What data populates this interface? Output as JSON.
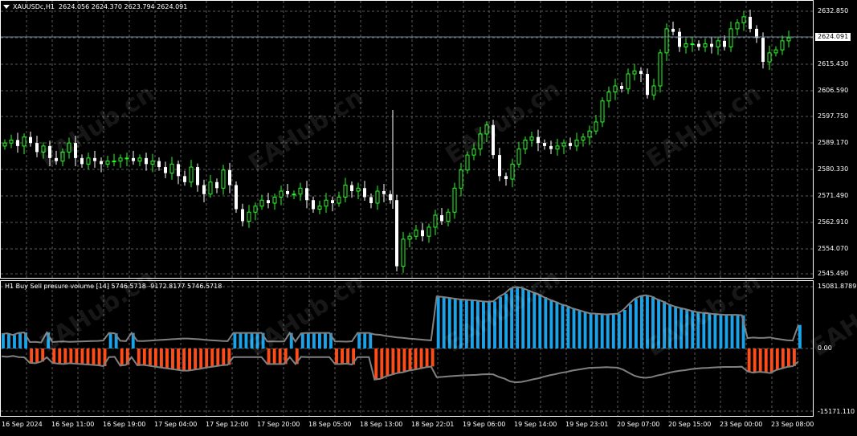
{
  "main_panel": {
    "symbol_title": "XAUUSDc,H1",
    "ohlc": "2624.056 2624.370 2623.794 2624.091",
    "current_price_label": "2624.091",
    "price_axis_labels": [
      "2632.850",
      "2615.430",
      "2606.590",
      "2597.750",
      "2589.170",
      "2580.330",
      "2571.490",
      "2562.910",
      "2554.070",
      "2545.490"
    ],
    "bull_color": "#22ff22",
    "bear_color": "#ffffff",
    "grid_color": "#5a5a5a"
  },
  "indicator_panel": {
    "title": "H1 Buy Sell presure volume [14] 5746.5718 -9172.8177 5746.5718",
    "axis_labels": [
      "15081.8789",
      "0.00",
      "-15171.110"
    ],
    "buy_color": "#1aa3e8",
    "sell_color": "#ff4d1a",
    "envelope_color": "#808080"
  },
  "time_axis": [
    "16 Sep 2024",
    "16 Sep 11:00",
    "16 Sep 19:00",
    "17 Sep 04:00",
    "17 Sep 12:00",
    "17 Sep 20:00",
    "18 Sep 05:00",
    "18 Sep 13:00",
    "18 Sep 22:01",
    "19 Sep 06:00",
    "19 Sep 14:00",
    "19 Sep 23:01",
    "20 Sep 07:00",
    "20 Sep 15:00",
    "23 Sep 00:00",
    "23 Sep 08:00"
  ],
  "watermark_text": "EAHub.cn",
  "chart_data": {
    "type": "candlestick",
    "title": "XAUUSDc,H1",
    "ylim": [
      2545.49,
      2632.85
    ],
    "close_series": [
      2589,
      2590,
      2588,
      2591,
      2589,
      2586,
      2588,
      2584,
      2583,
      2586,
      2589,
      2584,
      2582,
      2584,
      2583,
      2582,
      2583,
      2583,
      2584,
      2584,
      2583,
      2584,
      2582,
      2583,
      2581,
      2579,
      2582,
      2578,
      2576,
      2581,
      2575,
      2572,
      2576,
      2574,
      2580,
      2575,
      2567,
      2563,
      2566,
      2568,
      2570,
      2569,
      2571,
      2573,
      2572,
      2572,
      2574,
      2570,
      2567,
      2568,
      2570,
      2569,
      2571,
      2575,
      2573,
      2574,
      2571,
      2569,
      2573,
      2572,
      2570,
      2548,
      2557,
      2558,
      2560,
      2558,
      2561,
      2565,
      2563,
      2566,
      2574,
      2580,
      2585,
      2587,
      2592,
      2595,
      2585,
      2578,
      2577,
      2582,
      2587,
      2590,
      2591,
      2589,
      2588,
      2587,
      2588,
      2589,
      2588,
      2590,
      2591,
      2593,
      2596,
      2603,
      2606,
      2608,
      2607,
      2612,
      2613,
      2612,
      2605,
      2608,
      2619,
      2627,
      2626,
      2621,
      2622,
      2622,
      2621,
      2622,
      2621,
      2623,
      2621,
      2627,
      2629,
      2631,
      2627,
      2624,
      2616,
      2619,
      2620,
      2623,
      2624
    ],
    "pressure_series": [
      3500,
      3700,
      3300,
      3800,
      3900,
      -3500,
      -3600,
      -3200,
      3900,
      -3500,
      -3700,
      -3800,
      -3600,
      -3700,
      -3800,
      -3900,
      -4000,
      -4100,
      -4300,
      3800,
      3700,
      -4200,
      -4000,
      3800,
      -4100,
      -4000,
      -4200,
      -4400,
      -4600,
      -4800,
      -5000,
      -5200,
      -5400,
      -5400,
      -5200,
      -5000,
      -4700,
      -4500,
      -4300,
      -4100,
      -4000,
      3800,
      3800,
      3800,
      3800,
      3800,
      3800,
      -3800,
      -3800,
      -3800,
      -3800,
      3800,
      -3800,
      3700,
      3800,
      3800,
      3800,
      3800,
      3800,
      -3800,
      -3800,
      -3700,
      -3900,
      3800,
      3800,
      3800,
      -7600,
      -7400,
      -6800,
      -6400,
      -6000,
      -5800,
      -5400,
      -5200,
      -4900,
      -4600,
      -4400,
      12700,
      12600,
      12400,
      12200,
      12000,
      11900,
      11800,
      11700,
      11500,
      11400,
      11500,
      12600,
      13400,
      14600,
      15000,
      14800,
      14300,
      13700,
      13200,
      12500,
      11900,
      11400,
      10800,
      10400,
      9800,
      9400,
      9000,
      8600,
      8500,
      8400,
      8300,
      8400,
      8500,
      9400,
      10800,
      12100,
      12800,
      13000,
      12700,
      12000,
      11500,
      10800,
      10300,
      9900,
      9600,
      9200,
      8900,
      8700,
      8600,
      8400,
      8300,
      8200,
      8200,
      8200,
      8100,
      -5600,
      -5900,
      -5700,
      -5800,
      -6000,
      -5300,
      -4900,
      -4500,
      -4300,
      5746.57
    ]
  }
}
